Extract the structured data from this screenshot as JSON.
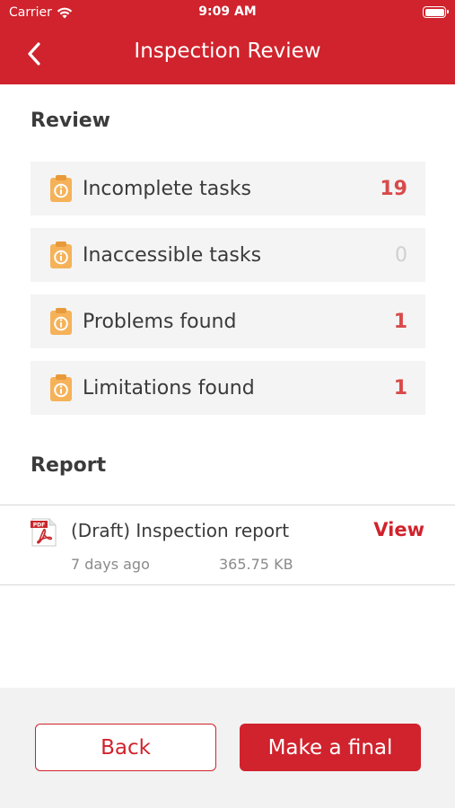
{
  "status_bar": {
    "carrier": "Carrier",
    "time": "9:09 AM"
  },
  "nav": {
    "title": "Inspection Review",
    "back_icon": "chevron-left-icon"
  },
  "review": {
    "heading": "Review",
    "items": [
      {
        "label": "Incomplete tasks",
        "count": "19",
        "icon": "clipboard-info-icon"
      },
      {
        "label": "Inaccessible tasks",
        "count": "0",
        "icon": "clipboard-info-icon"
      },
      {
        "label": "Problems found",
        "count": "1",
        "icon": "clipboard-info-icon"
      },
      {
        "label": "Limitations found",
        "count": "1",
        "icon": "clipboard-info-icon"
      }
    ]
  },
  "report": {
    "heading": "Report",
    "item": {
      "title": "(Draft) Inspection report",
      "view_label": "View",
      "age": "7 days ago",
      "size": "365.75 KB",
      "icon_label": "PDF"
    }
  },
  "footer": {
    "back_label": "Back",
    "final_label": "Make a final"
  },
  "colors": {
    "brand": "#d0232d",
    "count_accent": "#d94a4a",
    "icon_orange": "#f5b259",
    "row_bg": "#f4f4f4",
    "footer_bg": "#f2f2f2"
  }
}
